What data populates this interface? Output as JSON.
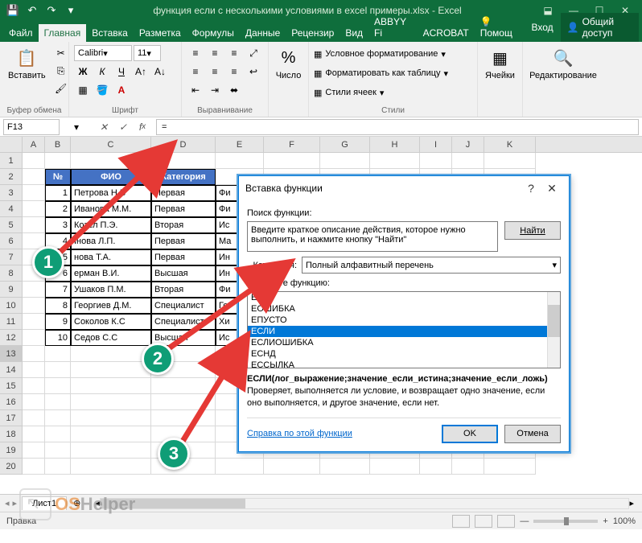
{
  "titlebar": {
    "title": "функция если с несколькими условиями в excel примеры.xlsx - Excel"
  },
  "ribbon": {
    "tabs": [
      "Файл",
      "Главная",
      "Вставка",
      "Разметка",
      "Формулы",
      "Данные",
      "Рецензир",
      "Вид",
      "ABBYY Fi",
      "ACROBAT"
    ],
    "help": "Помощ",
    "signin": "Вход",
    "share": "Общий доступ",
    "groups": {
      "clipboard": {
        "paste": "Вставить",
        "label": "Буфер обмена"
      },
      "font": {
        "name": "Calibri",
        "size": "11",
        "label": "Шрифт"
      },
      "align": {
        "label": "Выравнивание"
      },
      "number": {
        "btn": "Число",
        "label": ""
      },
      "styles": {
        "cond": "Условное форматирование",
        "table": "Форматировать как таблицу",
        "cell": "Стили ячеек",
        "label": "Стили"
      },
      "cells": {
        "btn": "Ячейки"
      },
      "editing": {
        "btn": "Редактирование"
      }
    }
  },
  "fbar": {
    "namebox": "F13",
    "formula": "="
  },
  "grid": {
    "cols": [
      "A",
      "B",
      "C",
      "D",
      "E",
      "F",
      "G",
      "H",
      "I",
      "J",
      "K"
    ],
    "widths": [
      28,
      32,
      100,
      80,
      60,
      70,
      62,
      62,
      40,
      40,
      64
    ],
    "rows": 20,
    "headers": {
      "num": "№",
      "fio": "ФИО",
      "cat": "Категория"
    },
    "data": [
      {
        "n": "1",
        "fio": "Петрова Н.В",
        "cat": "Первая",
        "e": "Фи"
      },
      {
        "n": "2",
        "fio": "Иванова М.М.",
        "cat": "Первая",
        "e": "Фи"
      },
      {
        "n": "3",
        "fio": "Козел П.Э.",
        "cat": "Вторая",
        "e": "Ис"
      },
      {
        "n": "4",
        "fio": "Інова Л.П.",
        "cat": "Первая",
        "e": "Ма"
      },
      {
        "n": "5",
        "fio": "нова Т.А.",
        "cat": "Первая",
        "e": "Ин"
      },
      {
        "n": "6",
        "fio": "ерман В.И.",
        "cat": "Высшая",
        "e": "Ин"
      },
      {
        "n": "7",
        "fio": "Ушаков П.М.",
        "cat": "Вторая",
        "e": "Фи"
      },
      {
        "n": "8",
        "fio": "Георгиев Д.М.",
        "cat": "Специалист",
        "e": "Ге"
      },
      {
        "n": "9",
        "fio": "Соколов К.С",
        "cat": "Специалист",
        "e": "Хи"
      },
      {
        "n": "10",
        "fio": "Седов С.С",
        "cat": "Высшая",
        "e": "Ис"
      }
    ],
    "selected_row": 13
  },
  "sheet": {
    "tab": "Лист1"
  },
  "status": {
    "mode": "Правка",
    "zoom": "100%"
  },
  "dialog": {
    "title": "Вставка функции",
    "search_label": "Поиск функции:",
    "search_hint": "Введите краткое описание действия, которое нужно выполнить, и нажмите кнопку \"Найти\"",
    "find_btn": "Найти",
    "category_label": "Категория:",
    "category_value": "Полный алфавитный перечень",
    "select_label": "Выберите функцию:",
    "functions": [
      "ЕОШ",
      "ЕОШИБКА",
      "ЕПУСТО",
      "ЕСЛИ",
      "ЕСЛИОШИБКА",
      "ЕСНД",
      "ЕССЫЛКА"
    ],
    "selected_index": 3,
    "signature": "ЕСЛИ(лог_выражение;значение_если_истина;значение_если_ложь)",
    "description": "Проверяет, выполняется ли условие, и возвращает одно значение, если оно выполняется, и другое значение, если нет.",
    "help_link": "Справка по этой функции",
    "ok": "OK",
    "cancel": "Отмена"
  },
  "watermark": {
    "text1": "OS",
    "text2": "Helper"
  },
  "callouts": [
    "1",
    "2",
    "3"
  ]
}
